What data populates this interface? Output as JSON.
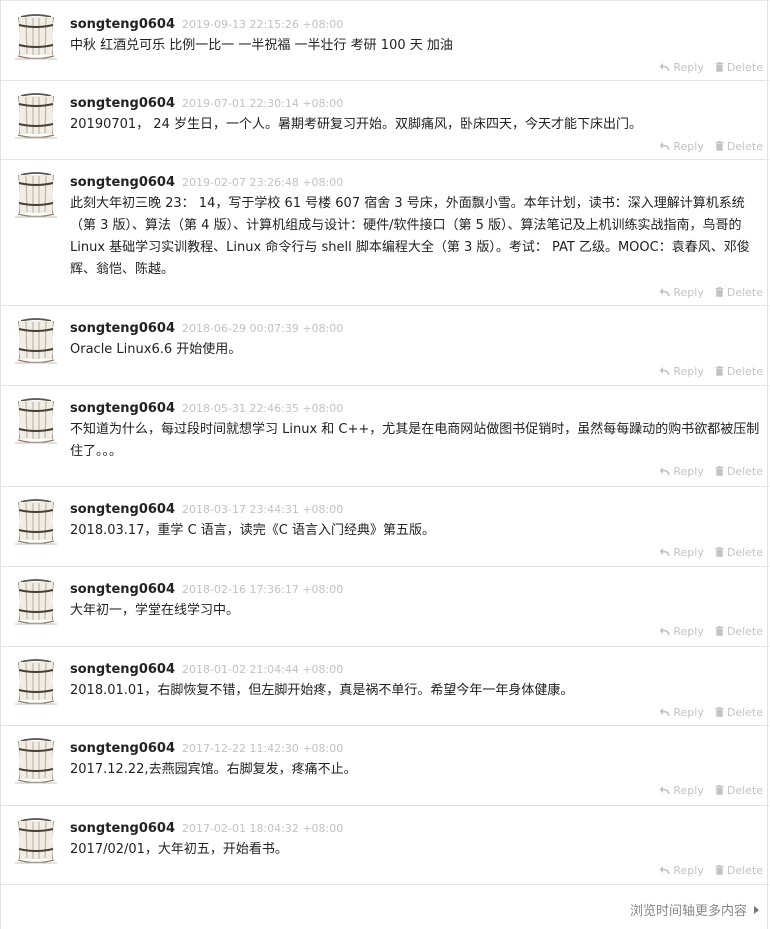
{
  "posts": [
    {
      "username": "songteng0604",
      "timestamp": "2019-09-13 22:15:26 +08:00",
      "content": "中秋 红酒兑可乐 比例一比一 一半祝福 一半壮行 考研 100 天 加油",
      "reply_label": "Reply",
      "delete_label": "Delete"
    },
    {
      "username": "songteng0604",
      "timestamp": "2019-07-01 22:30:14 +08:00",
      "content": "20190701， 24 岁生日，一个人。暑期考研复习开始。双脚痛风，卧床四天，今天才能下床出门。",
      "reply_label": "Reply",
      "delete_label": "Delete"
    },
    {
      "username": "songteng0604",
      "timestamp": "2019-02-07 23:26:48 +08:00",
      "content": "此刻大年初三晚 23： 14，写于学校 61 号楼 607 宿舍 3 号床，外面飘小雪。本年计划，读书：深入理解计算机系统（第 3 版）、算法（第 4 版）、计算机组成与设计：硬件/软件接口（第 5 版）、算法笔记及上机训练实战指南，鸟哥的 Linux 基础学习实训教程、Linux 命令行与 shell 脚本编程大全（第 3 版）。考试： PAT 乙级。MOOC：袁春风、邓俊辉、翁恺、陈越。",
      "reply_label": "Reply",
      "delete_label": "Delete"
    },
    {
      "username": "songteng0604",
      "timestamp": "2018-06-29 00:07:39 +08:00",
      "content": "Oracle Linux6.6 开始使用。",
      "reply_label": "Reply",
      "delete_label": "Delete"
    },
    {
      "username": "songteng0604",
      "timestamp": "2018-05-31 22:46:35 +08:00",
      "content": "不知道为什么，每过段时间就想学习 Linux 和 C++，尤其是在电商网站做图书促销时，虽然每每躁动的购书欲都被压制住了。。。",
      "reply_label": "Reply",
      "delete_label": "Delete"
    },
    {
      "username": "songteng0604",
      "timestamp": "2018-03-17 23:44:31 +08:00",
      "content": "2018.03.17，重学 C 语言，读完《C 语言入门经典》第五版。",
      "reply_label": "Reply",
      "delete_label": "Delete"
    },
    {
      "username": "songteng0604",
      "timestamp": "2018-02-16 17:36:17 +08:00",
      "content": "大年初一，学堂在线学习中。",
      "reply_label": "Reply",
      "delete_label": "Delete"
    },
    {
      "username": "songteng0604",
      "timestamp": "2018-01-02 21:04:44 +08:00",
      "content": "2018.01.01，右脚恢复不错，但左脚开始疼，真是祸不单行。希望今年一年身体健康。",
      "reply_label": "Reply",
      "delete_label": "Delete"
    },
    {
      "username": "songteng0604",
      "timestamp": "2017-12-22 11:42:30 +08:00",
      "content": "2017.12.22,去燕园宾馆。右脚复发，疼痛不止。",
      "reply_label": "Reply",
      "delete_label": "Delete"
    },
    {
      "username": "songteng0604",
      "timestamp": "2017-02-01 18:04:32 +08:00",
      "content": "2017/02/01，大年初五，开始看书。",
      "reply_label": "Reply",
      "delete_label": "Delete"
    }
  ],
  "footer": {
    "more_link": "浏览时间轴更多内容"
  },
  "colors": {
    "text": "#222222",
    "timestamp": "#c2c2c2",
    "action": "#c3c3c3",
    "divider": "#e3e3e3",
    "footer_link": "#888888"
  },
  "icons": {
    "avatar": "wooden-bucket-icon",
    "reply": "reply-arrow-icon",
    "delete": "trash-icon",
    "footer": "triangle-right-icon"
  }
}
